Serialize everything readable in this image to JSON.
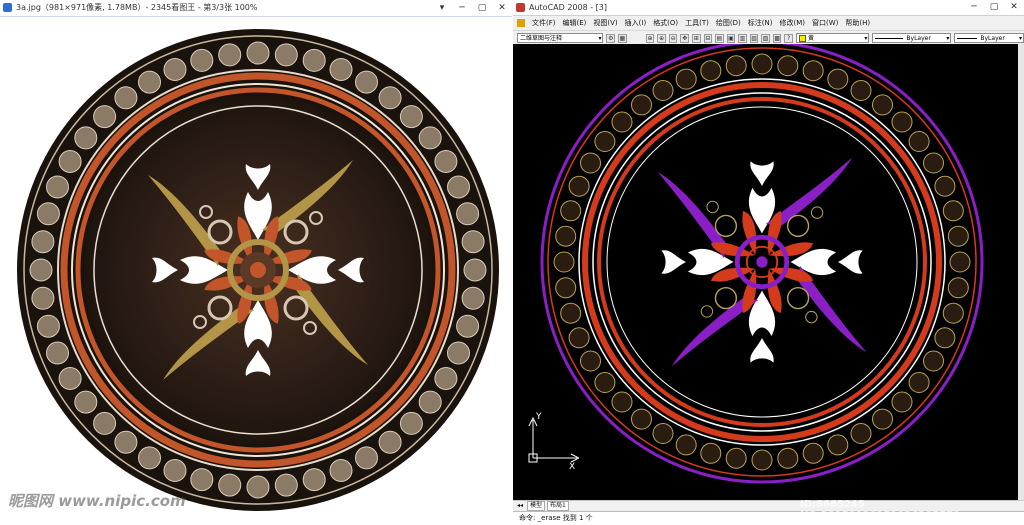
{
  "viewer": {
    "title": "3a.jpg（981×971像素, 1.78MB）- 2345看图王 - 第3/3张 100%",
    "controls": [
      "▾",
      "─",
      "▢",
      "✕"
    ]
  },
  "cad": {
    "title": "AutoCAD 2008 - [3]",
    "controls": [
      "─",
      "▢",
      "✕"
    ],
    "menu": [
      "文件(F)",
      "编辑(E)",
      "视图(V)",
      "插入(I)",
      "格式(O)",
      "工具(T)",
      "绘图(D)",
      "标注(N)",
      "修改(M)",
      "窗口(W)",
      "帮助(H)"
    ],
    "workspace": "二维草图与注释",
    "color_value": "黄",
    "linetype_value": "ByLayer",
    "lineweight_value": "ByLayer",
    "tabs": [
      "模型",
      "布局1"
    ],
    "command_prompt": "命令: _erase 找到 1 个",
    "ucs_x": "X",
    "ucs_y": "Y"
  },
  "watermark_left": "昵图网 www.nipic.com",
  "watermark_right": "ID:8665245 NO:20150920151926205779",
  "colors": {
    "marble_dark": "#3b2a1e",
    "terracotta": "#c2552a",
    "gold": "#b39548",
    "cad_purple": "#8a1fc6",
    "cad_red": "#d43a1c"
  }
}
